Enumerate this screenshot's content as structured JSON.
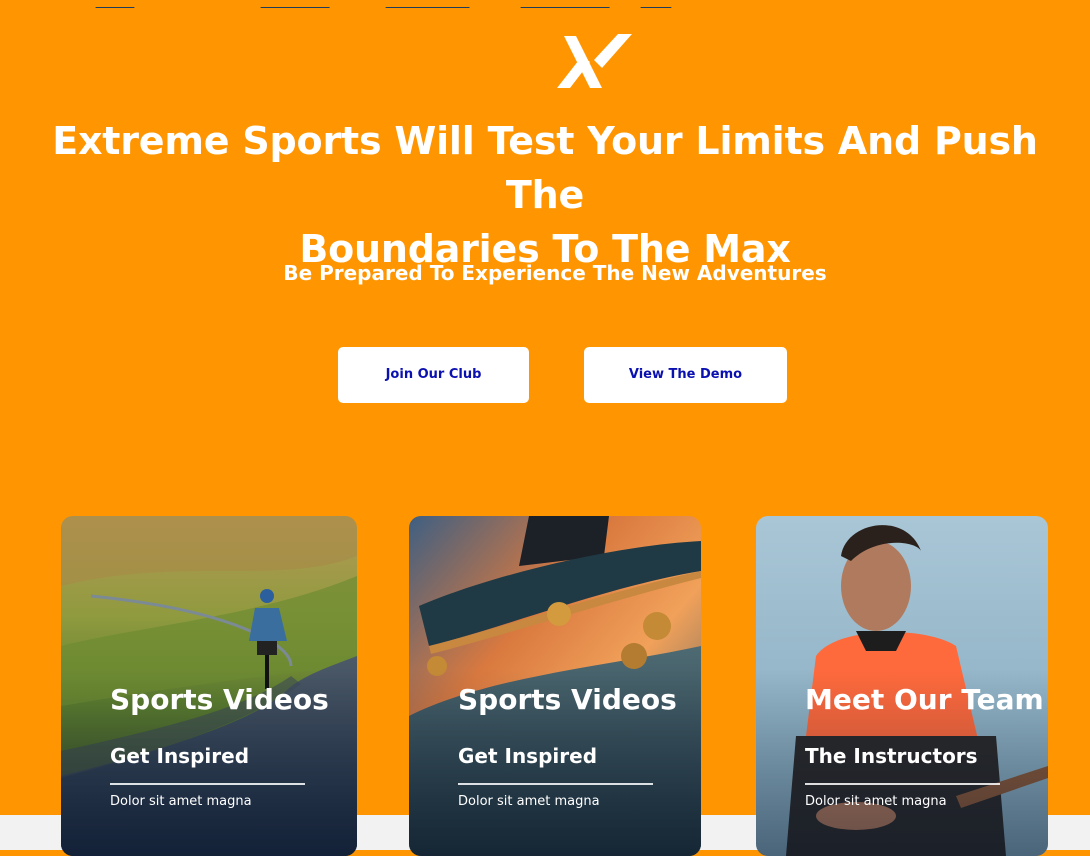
{
  "colors": {
    "background": "#ff9500",
    "button_text": "#0b10b0",
    "strip": "#f2f2f2"
  },
  "logo": {
    "icon": "x-logo-icon"
  },
  "hero": {
    "headline_line1": "Extreme Sports Will Test Your Limits And Push The",
    "headline_line2": "Boundaries To The Max",
    "subheadline": "Be Prepared To Experience The New Adventures"
  },
  "buttons": {
    "join": "Join Our Club",
    "demo": "View The Demo"
  },
  "cards": [
    {
      "title": "Sports Videos",
      "subtitle": "Get Inspired",
      "text": "Dolor sit amet magna"
    },
    {
      "title": "Sports Videos",
      "subtitle": "Get Inspired",
      "text": "Dolor sit amet magna"
    },
    {
      "title": "Meet Our Team",
      "subtitle": "The Instructors",
      "text": "Dolor sit amet magna"
    }
  ]
}
